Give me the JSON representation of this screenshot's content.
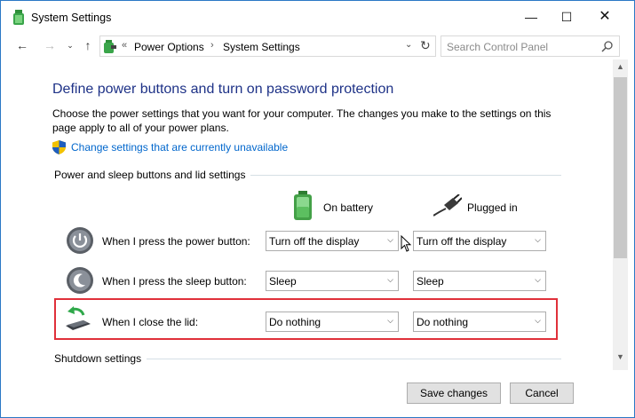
{
  "window": {
    "title": "System Settings",
    "controls": {
      "minimize": "—",
      "maximize": "☐",
      "close": "✕"
    }
  },
  "nav": {
    "back": "←",
    "forward": "→",
    "recent": "⌄",
    "up": "↑",
    "breadcrumb_prefix": "«",
    "breadcrumb": [
      "Power Options",
      "System Settings"
    ],
    "breadcrumb_sep": "›",
    "dropdown": "⌄",
    "refresh": "↻"
  },
  "search": {
    "placeholder": "Search Control Panel"
  },
  "main": {
    "heading": "Define power buttons and turn on password protection",
    "description": "Choose the power settings that you want for your computer. The changes you make to the settings on this page apply to all of your power plans.",
    "link": "Change settings that are currently unavailable",
    "section_buttons": "Power and sleep buttons and lid settings",
    "section_shutdown": "Shutdown settings",
    "columns": {
      "battery": "On battery",
      "plugged": "Plugged in"
    },
    "rows": [
      {
        "label": "When I press the power button:",
        "icon": "power-button-icon",
        "battery": "Turn off the display",
        "plugged": "Turn off the display"
      },
      {
        "label": "When I press the sleep button:",
        "icon": "sleep-button-icon",
        "battery": "Sleep",
        "plugged": "Sleep"
      },
      {
        "label": "When I close the lid:",
        "icon": "laptop-lid-icon",
        "battery": "Do nothing",
        "plugged": "Do nothing"
      }
    ]
  },
  "footer": {
    "save": "Save changes",
    "cancel": "Cancel"
  },
  "colors": {
    "heading": "#1e3287",
    "link": "#0066cc",
    "highlight": "#e0303a",
    "frame": "#2b78c5"
  }
}
